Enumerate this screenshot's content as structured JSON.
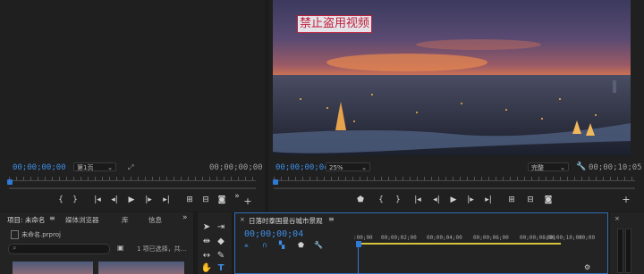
{
  "source_monitor": {
    "timecode_left": "00;00;00;00",
    "page_select": "第1页",
    "timecode_right": "00;00;00;00"
  },
  "program_monitor": {
    "watermark": "禁止盗用视频",
    "timecode_left": "00;00;00;04",
    "zoom": "25%",
    "quality": "完整",
    "timecode_right": "00;00;10;05"
  },
  "project_panel": {
    "tabs": [
      "项目: 未命名",
      "媒体浏览器",
      "库",
      "信息"
    ],
    "project_file": "未命名.prproj",
    "selection_status": "1 项已选择，共..."
  },
  "timeline": {
    "sequence_name": "日落时泰国曼谷城市景观",
    "timecode": "00;00;00;04",
    "ruler_labels": [
      ":00;00",
      "00;00;02;00",
      "00;00;04;00",
      "00;00;06;00",
      "00;00;08;00",
      "00;00;10;00",
      "00;00"
    ]
  },
  "colors": {
    "accent_blue": "#3d8ee6",
    "in_out_yellow": "#d6c43a",
    "watermark_red": "#c0203a"
  }
}
